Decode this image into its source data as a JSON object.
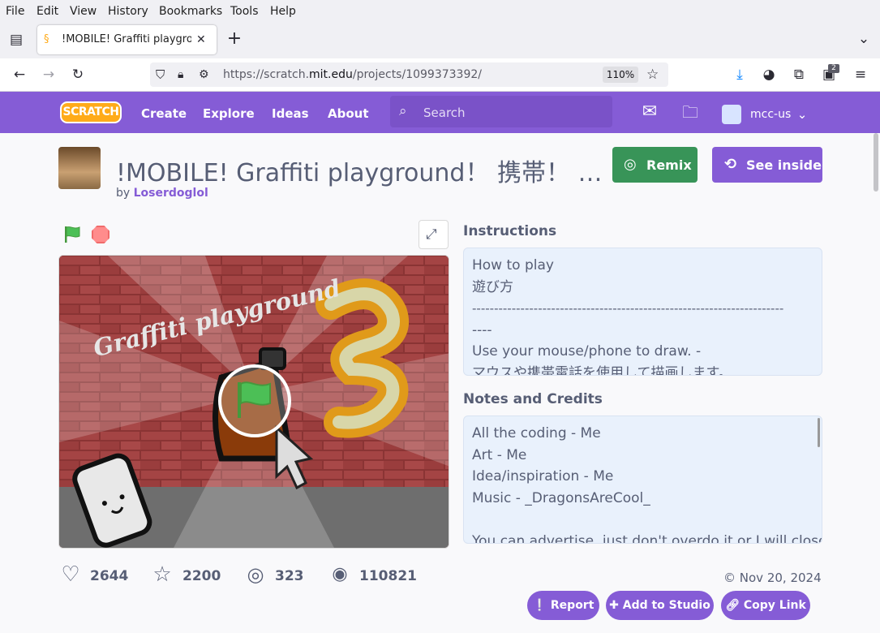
{
  "browser": {
    "menu": [
      "File",
      "Edit",
      "View",
      "History",
      "Bookmarks",
      "Tools",
      "Help"
    ],
    "tab_title": "!MOBILE! Graffiti playground",
    "url_prefix": "https://scratch.",
    "url_domain": "mit.edu",
    "url_path": "/projects/1099373392/",
    "zoom": "110%",
    "extensions_badge": "2"
  },
  "scratch_header": {
    "logo": "SCRATCH",
    "nav": [
      "Create",
      "Explore",
      "Ideas",
      "About"
    ],
    "search_placeholder": "Search",
    "username": "mcc-us"
  },
  "project": {
    "title": "!MOBILE! Graffiti playground！ 携帯！ …",
    "by_label": "by",
    "author": "Loserdoglol",
    "remix_label": "Remix",
    "see_inside_label": "See inside",
    "stage_title_art": "Graffiti playground",
    "instructions_heading": "Instructions",
    "instructions_lines": [
      "How to play",
      "遊び方",
      "-----------------------------------------------------------------------",
      "----",
      "Use your mouse/phone to draw. -",
      "マウスや携帯電話を使用して描画します。"
    ],
    "notes_heading": "Notes and Credits",
    "notes_lines": [
      "All the coding - Me",
      "Art - Me",
      "Idea/inspiration - Me",
      "Music - _DragonsAreCool_",
      "",
      "You can advertise, just don't overdo it or I will close"
    ],
    "stats": {
      "loves": "2644",
      "favorites": "2200",
      "remixes": "323",
      "views": "110821"
    },
    "date": "Nov 20, 2024",
    "report_label": "Report",
    "add_to_studio_label": "Add to Studio",
    "copy_link_label": "Copy Link"
  },
  "colors": {
    "scratch_purple": "#855cd6",
    "remix_green": "#389458",
    "text": "#575e75"
  }
}
